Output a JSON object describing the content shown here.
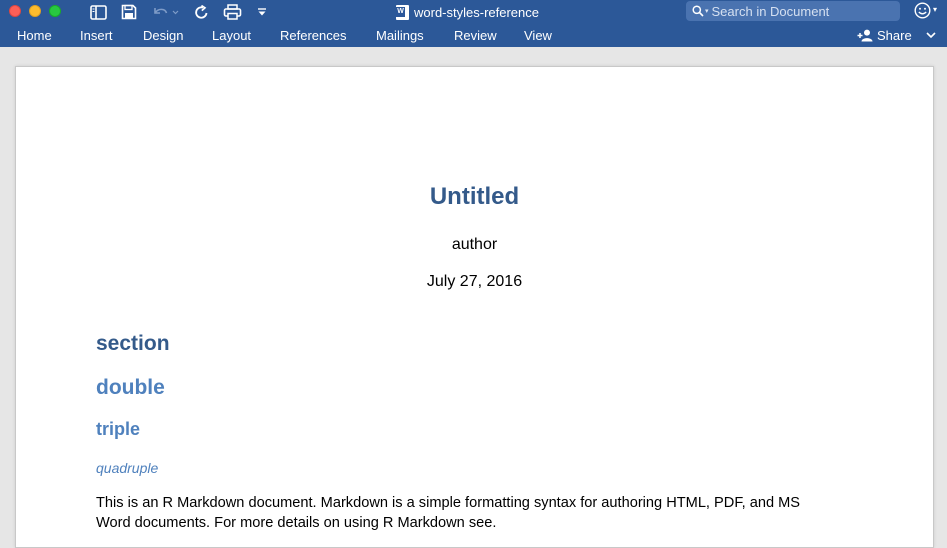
{
  "window": {
    "document_name": "word-styles-reference",
    "doc_icon_letter": "W"
  },
  "search": {
    "placeholder": "Search in Document"
  },
  "ribbon": {
    "tabs": [
      "Home",
      "Insert",
      "Design",
      "Layout",
      "References",
      "Mailings",
      "Review",
      "View"
    ],
    "share_label": "Share"
  },
  "document": {
    "title": "Untitled",
    "author": "author",
    "date": "July 27, 2016",
    "heading1": "section",
    "heading2": "double",
    "heading3": "triple",
    "heading4": "quadruple",
    "body": "This is an R Markdown document. Markdown is a simple formatting syntax for authoring HTML, PDF, and MS Word documents. For more details on using R Markdown see."
  },
  "colors": {
    "titlebar": "#2c5898",
    "title_heading": "#345a8a",
    "sub_heading": "#4f81bd"
  },
  "icons": [
    "sidebar-icon",
    "save-icon",
    "undo-icon",
    "redo-icon",
    "print-icon",
    "customize-caret-icon",
    "search-icon",
    "smiley-icon",
    "add-person-icon",
    "chevron-down-icon"
  ]
}
